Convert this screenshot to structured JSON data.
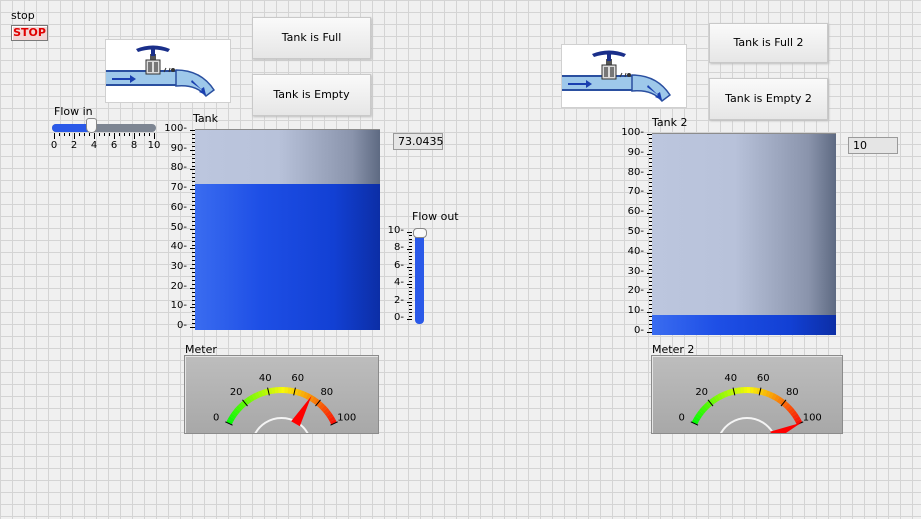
{
  "stop": {
    "caption": "stop",
    "button_label": "STOP"
  },
  "left": {
    "tank_full_label": "Tank is Full",
    "tank_empty_label": "Tank is Empty",
    "flow_in": {
      "label": "Flow in",
      "ticks": [
        "0",
        "2",
        "4",
        "6",
        "8",
        "10"
      ],
      "value": 3.5,
      "max": 10
    },
    "tank": {
      "label": "Tank",
      "value": 73.0435,
      "value_text": "73.0435",
      "max": 100,
      "ticks": [
        "100",
        "90",
        "80",
        "70",
        "60",
        "50",
        "40",
        "30",
        "20",
        "10",
        "0"
      ]
    },
    "flow_out": {
      "label": "Flow out",
      "value": 10,
      "ticks": [
        "10",
        "8",
        "6",
        "4",
        "2",
        "0"
      ]
    },
    "meter": {
      "label": "Meter",
      "ticks": [
        "0",
        "20",
        "40",
        "60",
        "80",
        "100"
      ],
      "value": 73.0435
    }
  },
  "right": {
    "tank_full_label": "Tank is Full 2",
    "tank_empty_label": "Tank is Empty 2",
    "tank": {
      "label": "Tank 2",
      "value": 10,
      "value_text": "10",
      "max": 100,
      "ticks": [
        "100",
        "90",
        "80",
        "70",
        "60",
        "50",
        "40",
        "30",
        "20",
        "10",
        "0"
      ]
    },
    "meter": {
      "label": "Meter 2",
      "ticks": [
        "0",
        "20",
        "40",
        "60",
        "80",
        "100"
      ],
      "value": 100
    }
  },
  "colors": {
    "tank_fill": "#1e4fe6",
    "tank_empty": "#bcc6de",
    "stop_text": "#e00000"
  }
}
